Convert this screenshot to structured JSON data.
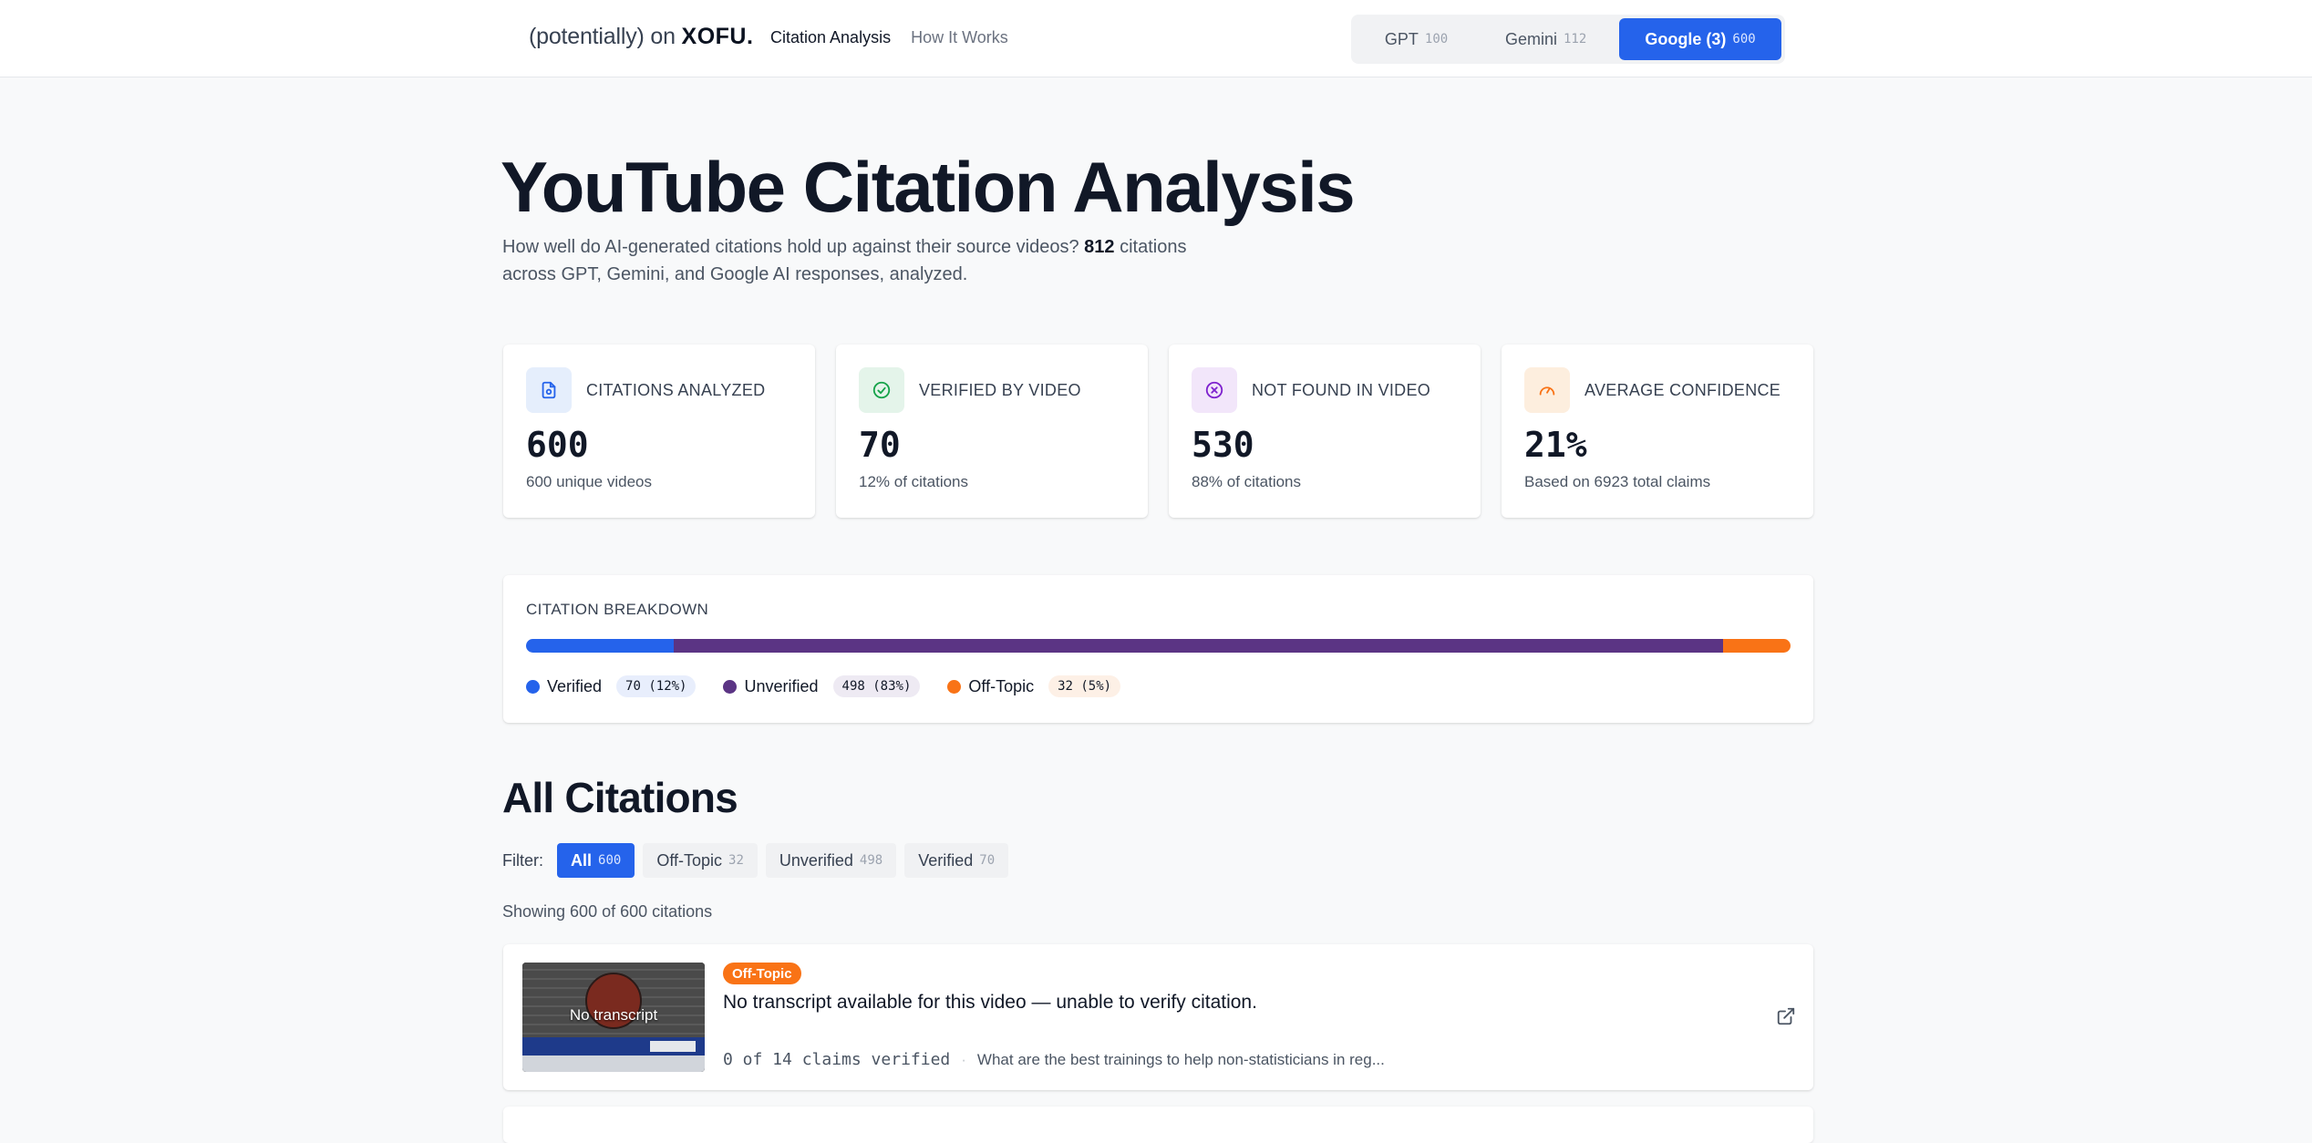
{
  "nav": {
    "brand_prefix": "(potentially) on",
    "brand_name": "XOFU.",
    "links": [
      {
        "label": "Citation Analysis"
      },
      {
        "label": "How It Works"
      }
    ],
    "models": [
      {
        "label": "GPT",
        "count": "100"
      },
      {
        "label": "Gemini",
        "count": "112"
      },
      {
        "label": "Google (3)",
        "count": "600"
      }
    ]
  },
  "hero": {
    "title": "YouTube Citation Analysis",
    "subtitle_pre": "How well do AI-generated citations hold up against their source videos?",
    "subtitle_count": "812",
    "subtitle_post": "citations across GPT, Gemini, and Google AI responses, analyzed."
  },
  "stats": [
    {
      "label": "CITATIONS ANALYZED",
      "value": "600",
      "note": "600 unique videos",
      "icon": "document-icon",
      "color": "#2563eb"
    },
    {
      "label": "VERIFIED BY VIDEO",
      "value": "70",
      "note": "12% of citations",
      "icon": "check-circle-icon",
      "color": "#16a34a"
    },
    {
      "label": "NOT FOUND IN VIDEO",
      "value": "530",
      "note": "88% of citations",
      "icon": "x-circle-icon",
      "color": "#7e22ce"
    },
    {
      "label": "AVERAGE CONFIDENCE",
      "value": "21%",
      "note": "Based on 6923 total claims",
      "icon": "gauge-icon",
      "color": "#f97316"
    }
  ],
  "breakdown": {
    "title": "CITATION BREAKDOWN",
    "segments": [
      {
        "label": "Verified",
        "count": "70 (12%)",
        "fraction": 0.117,
        "color": "#2563eb",
        "pill_bg": "#e8eefc"
      },
      {
        "label": "Unverified",
        "count": "498 (83%)",
        "fraction": 0.83,
        "color": "#5b3484",
        "pill_bg": "#eeeaf3"
      },
      {
        "label": "Off-Topic",
        "count": "32 (5%)",
        "fraction": 0.053,
        "color": "#f97316",
        "pill_bg": "#fdf0e6"
      }
    ]
  },
  "citations": {
    "title": "All Citations",
    "filter_label": "Filter:",
    "filters": [
      {
        "label": "All",
        "count": "600"
      },
      {
        "label": "Off-Topic",
        "count": "32"
      },
      {
        "label": "Unverified",
        "count": "498"
      },
      {
        "label": "Verified",
        "count": "70"
      }
    ],
    "showing": "Showing 600 of 600 citations",
    "items": [
      {
        "badge": "Off-Topic",
        "thumb_text": "No transcript",
        "title": "No transcript available for this video — unable to verify citation.",
        "claims": "0 of 14 claims verified",
        "separator": "·",
        "query": "What are the best trainings to help non-statisticians in reg..."
      }
    ]
  }
}
